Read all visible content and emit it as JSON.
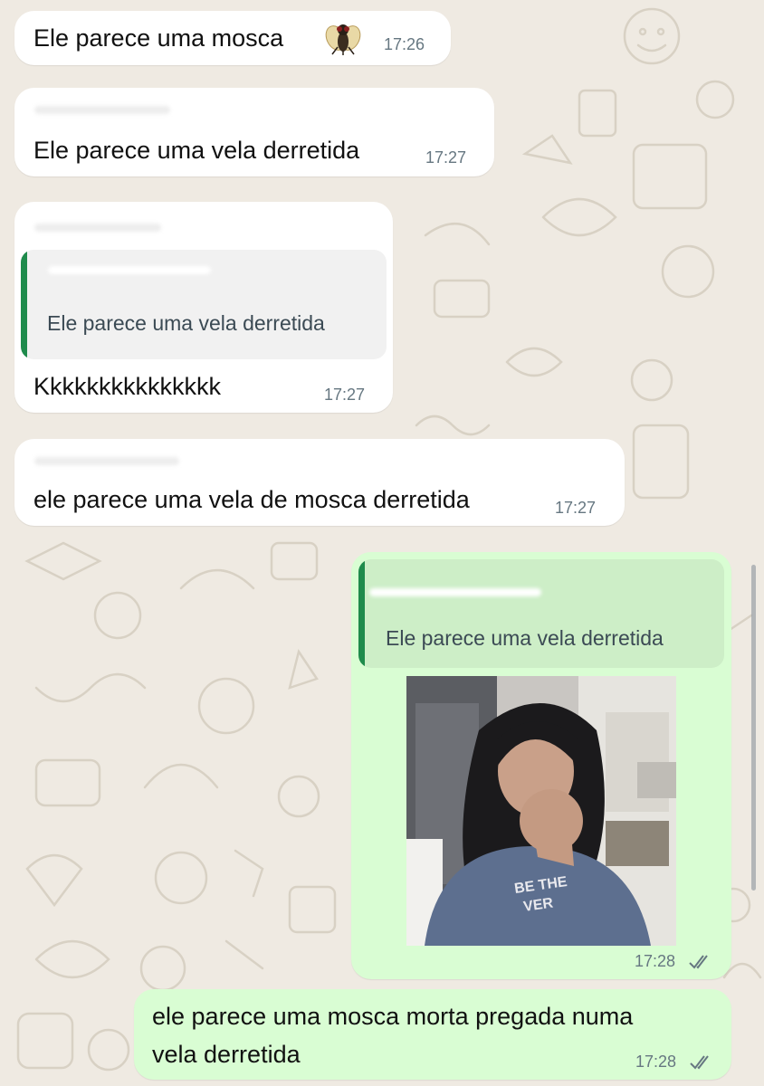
{
  "colors": {
    "incoming": "#ffffff",
    "outgoing": "#d9fdd3",
    "quote_bar": "#1f8b4c",
    "background": "#efeae2"
  },
  "messages": [
    {
      "direction": "incoming",
      "text": "Ele parece uma mosca",
      "emoji": "fly-emoji",
      "time": "17:26"
    },
    {
      "direction": "incoming",
      "text": "Ele parece uma vela derretida",
      "time": "17:27"
    },
    {
      "direction": "incoming",
      "quote": "Ele parece uma vela derretida",
      "text": "Kkkkkkkkkkkkkkk",
      "time": "17:27"
    },
    {
      "direction": "incoming",
      "text": "ele parece uma vela de mosca derretida",
      "time": "17:27"
    },
    {
      "direction": "outgoing",
      "quote": "Ele parece uma vela derretida",
      "media": "photo",
      "time": "17:28",
      "status": "read-double-check"
    },
    {
      "direction": "outgoing",
      "text_line1": "ele parece uma mosca morta pregada numa",
      "text_line2": "vela derretida",
      "time": "17:28",
      "status": "read-double-check"
    }
  ]
}
